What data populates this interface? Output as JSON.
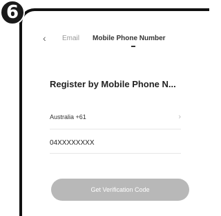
{
  "step": {
    "number": "6"
  },
  "nav": {
    "back_icon": "chevron-left-icon",
    "tab_email": "Email",
    "tab_mobile": "Mobile Phone Number"
  },
  "form": {
    "heading": "Register by Mobile Phone N...",
    "country": "Australia +61",
    "country_chevron": "chevron-right-icon",
    "phone_value": "04XXXXXXXX",
    "submit_label": "Get Verification Code"
  },
  "colors": {
    "badge": "#1a1a1a",
    "button_disabled": "#b8b8b8",
    "text_primary": "#222222",
    "text_muted": "#999999"
  }
}
